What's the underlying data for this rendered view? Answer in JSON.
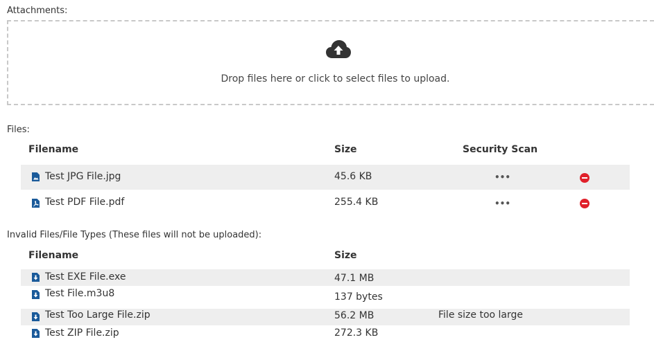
{
  "attachments_label": "Attachments:",
  "dropzone": {
    "icon": "cloud-upload-icon",
    "text": "Drop files here or click to select files to upload."
  },
  "files": {
    "label": "Files:",
    "headers": {
      "filename": "Filename",
      "size": "Size",
      "security_scan": "Security Scan"
    },
    "rows": [
      {
        "name": "Test JPG File.jpg",
        "size": "45.6 KB",
        "scan": "•••",
        "icon": "image-file-icon"
      },
      {
        "name": "Test PDF File.pdf",
        "size": "255.4 KB",
        "scan": "•••",
        "icon": "pdf-file-icon"
      }
    ]
  },
  "invalid": {
    "label": "Invalid Files/File Types (These files will not be uploaded):",
    "headers": {
      "filename": "Filename",
      "size": "Size"
    },
    "rows": [
      {
        "name": "Test EXE File.exe",
        "size": "47.1 MB",
        "note": "",
        "icon": "download-file-icon"
      },
      {
        "name": "Test File.m3u8",
        "size": "137 bytes",
        "note": "",
        "icon": "download-file-icon"
      },
      {
        "name": "Test Too Large File.zip",
        "size": "56.2 MB",
        "note": "File size too large",
        "icon": "download-file-icon"
      },
      {
        "name": "Test ZIP File.zip",
        "size": "272.3 KB",
        "note": "",
        "icon": "download-file-icon"
      }
    ]
  },
  "colors": {
    "accent": "#1a5a9a",
    "remove": "#e0202a",
    "row_shade": "#eeeeee",
    "dash": "#c8c8c8"
  }
}
